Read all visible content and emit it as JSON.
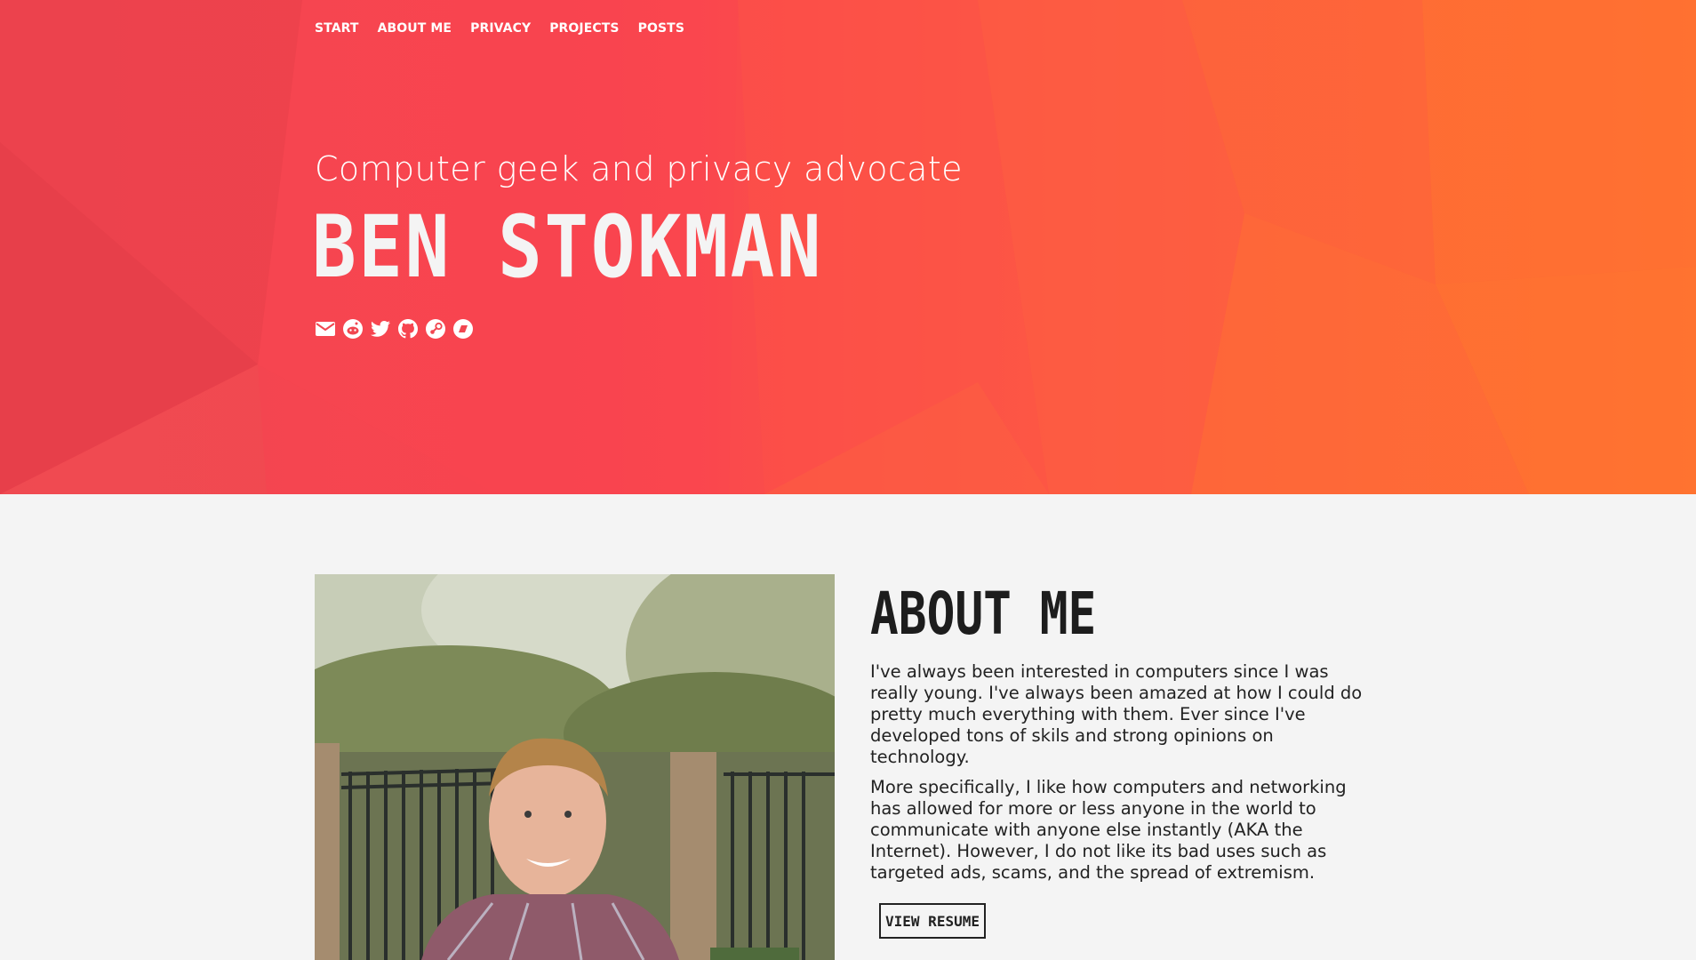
{
  "nav": {
    "items": [
      {
        "label": "START"
      },
      {
        "label": "ABOUT ME"
      },
      {
        "label": "PRIVACY"
      },
      {
        "label": "PROJECTS"
      },
      {
        "label": "POSTS"
      }
    ]
  },
  "hero": {
    "tagline": "Computer geek and privacy advocate",
    "name": "BEN STOKMAN",
    "social_icons": [
      "email-icon",
      "reddit-icon",
      "twitter-icon",
      "github-icon",
      "steam-icon",
      "keybase-icon"
    ]
  },
  "about": {
    "title": "ABOUT ME",
    "paragraphs": [
      "I've always been interested in computers since I was really young. I've always been amazed at how I could do pretty much everything with them. Ever since I've developed tons of skils and strong opinions on technology.",
      "More specifically, I like how computers and networking has allowed for more or less anyone in the world to communicate with anyone else instantly (AKA the Internet). However, I do not like its bad uses such as targeted ads, scams, and the spread of extremism."
    ],
    "resume_label": "VIEW RESUME"
  },
  "colors": {
    "hero_left": "#f14650",
    "hero_right": "#fe6f33",
    "page_bg": "#f4f4f4",
    "text_dark": "#1d1d1d"
  }
}
